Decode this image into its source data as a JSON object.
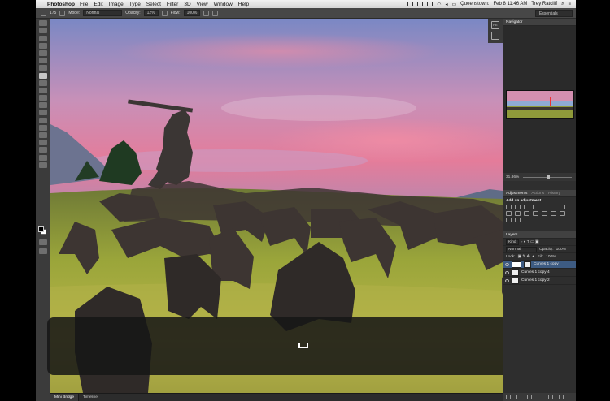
{
  "menubar": {
    "apple_symbol": "",
    "app_name": "Photoshop",
    "items": [
      "File",
      "Edit",
      "Image",
      "Type",
      "Select",
      "Filter",
      "3D",
      "View",
      "Window",
      "Help"
    ],
    "city": "Queenstown:",
    "clock": "Feb 8  11:46 AM",
    "user": "Trey Ratcliff"
  },
  "options": {
    "brush_size": "175",
    "mode_label": "Mode:",
    "mode_value": "Normal",
    "opacity_label": "Opacity:",
    "opacity_value": "12%",
    "flow_label": "Flow:",
    "flow_value": "100%",
    "workspace": "Essentials"
  },
  "strip": {
    "badge": "RE"
  },
  "navigator": {
    "title": "Navigator",
    "zoom": "31.86%"
  },
  "adjustments": {
    "tabs": [
      "Adjustments",
      "Actions",
      "History"
    ],
    "heading": "Add an adjustment"
  },
  "layers": {
    "title": "Layers",
    "kind_label": "Kind",
    "blend": "Normal",
    "opacity_label": "Opacity:",
    "opacity_value": "100%",
    "lock_label": "Lock:",
    "fill_label": "Fill:",
    "fill_value": "100%",
    "items": [
      "Curves 1 copy",
      "Curves 1 copy 4",
      "Curves 1 copy 2"
    ]
  },
  "bottom_tabs": [
    "Mini Bridge",
    "Timeline"
  ]
}
